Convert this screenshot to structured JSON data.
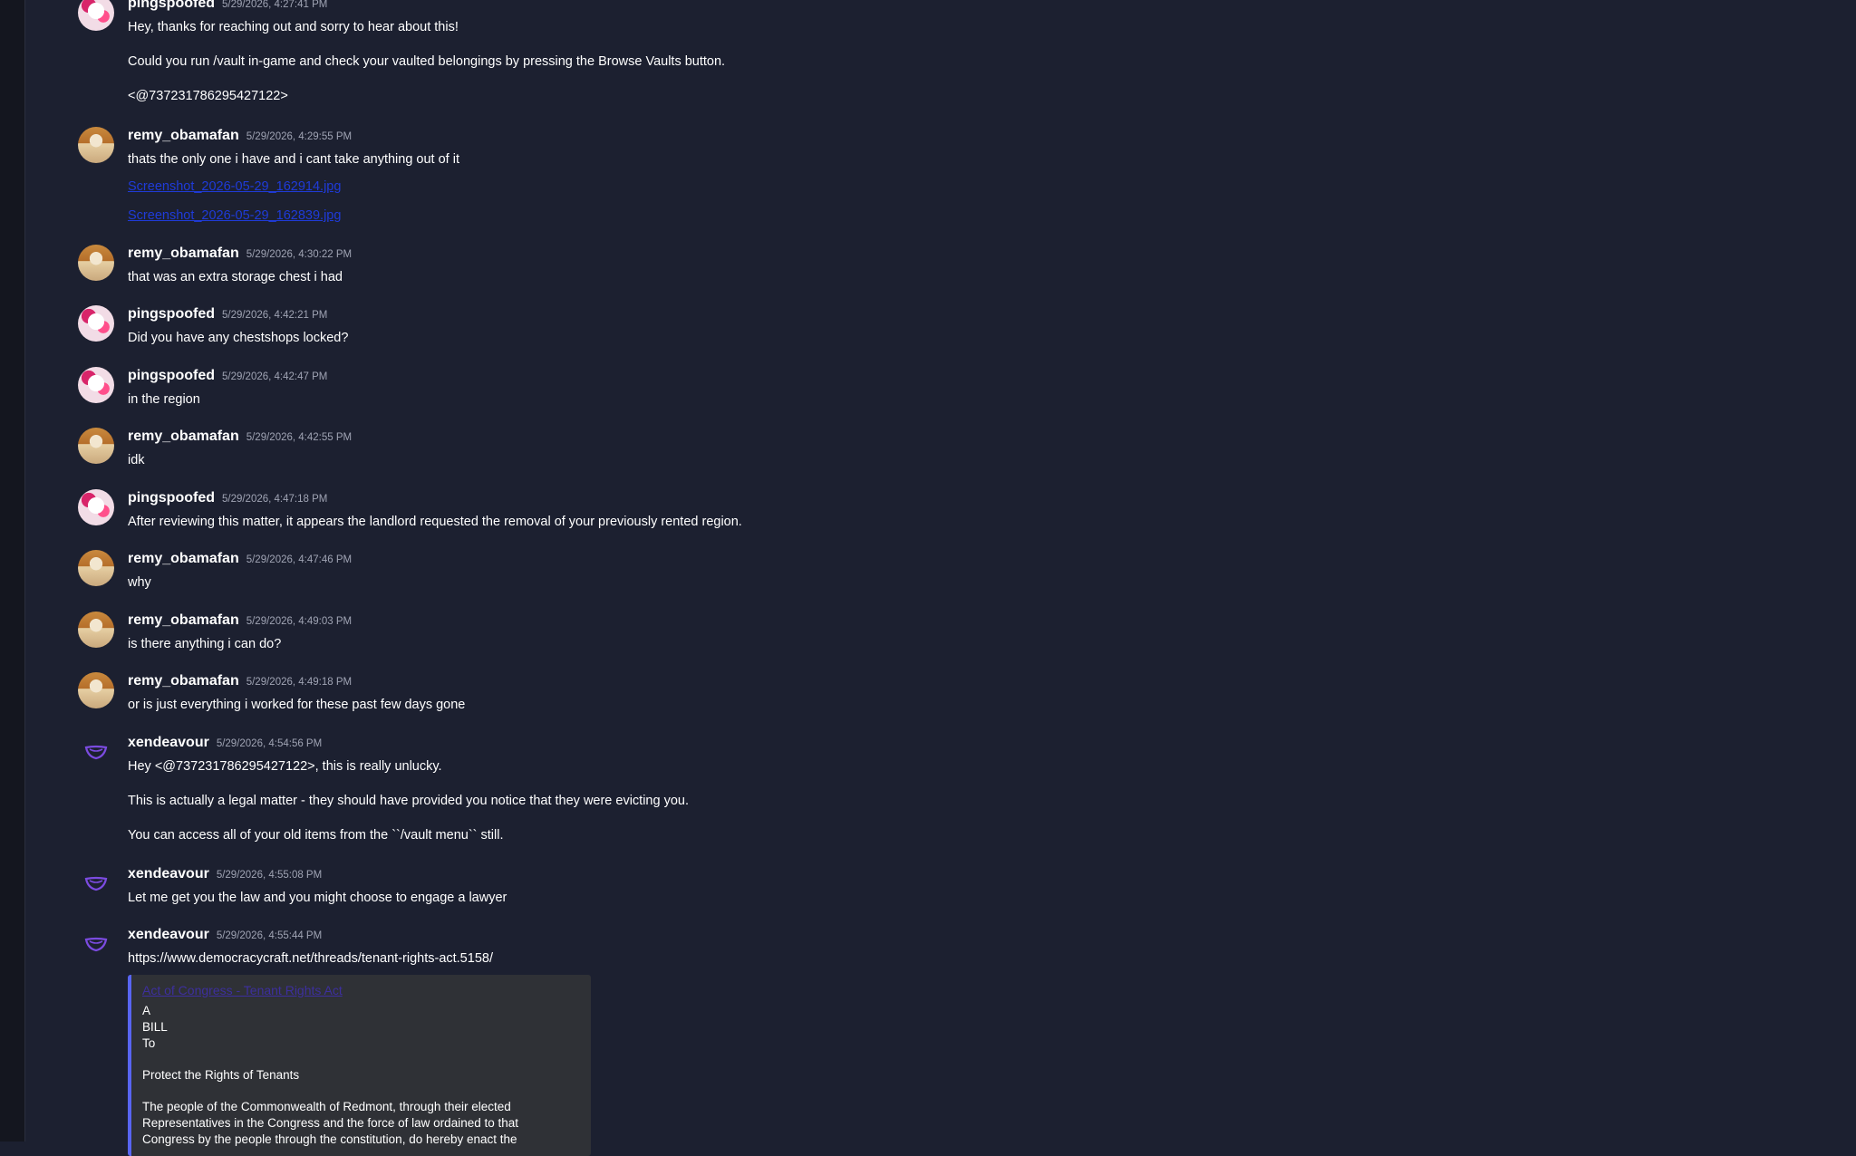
{
  "messages": [
    {
      "user": "pingspoofed",
      "time": "5/29/2026, 4:27:41 PM",
      "avatar": "ping",
      "lines": [
        "Hey, thanks for reaching out and sorry to hear about this!",
        "Could you run /vault in-game and check your vaulted belongings by pressing the Browse Vaults button.",
        "<@737231786295427122>"
      ]
    },
    {
      "user": "remy_obamafan",
      "time": "5/29/2026, 4:29:55 PM",
      "avatar": "remy",
      "lines": [
        "thats the only one i have and i cant take anything out of it"
      ],
      "links": [
        "Screenshot_2026-05-29_162914.jpg",
        "Screenshot_2026-05-29_162839.jpg"
      ]
    },
    {
      "user": "remy_obamafan",
      "time": "5/29/2026, 4:30:22 PM",
      "avatar": "remy",
      "lines": [
        "that was an extra storage chest i had"
      ]
    },
    {
      "user": "pingspoofed",
      "time": "5/29/2026, 4:42:21 PM",
      "avatar": "ping",
      "lines": [
        "Did you have any chestshops locked?"
      ]
    },
    {
      "user": "pingspoofed",
      "time": "5/29/2026, 4:42:47 PM",
      "avatar": "ping",
      "lines": [
        "in the region"
      ]
    },
    {
      "user": "remy_obamafan",
      "time": "5/29/2026, 4:42:55 PM",
      "avatar": "remy",
      "lines": [
        "idk"
      ]
    },
    {
      "user": "pingspoofed",
      "time": "5/29/2026, 4:47:18 PM",
      "avatar": "ping",
      "lines": [
        "After reviewing this matter, it appears the landlord requested the removal of your previously rented region."
      ]
    },
    {
      "user": "remy_obamafan",
      "time": "5/29/2026, 4:47:46 PM",
      "avatar": "remy",
      "lines": [
        "why"
      ]
    },
    {
      "user": "remy_obamafan",
      "time": "5/29/2026, 4:49:03 PM",
      "avatar": "remy",
      "lines": [
        "is there anything i can do?"
      ]
    },
    {
      "user": "remy_obamafan",
      "time": "5/29/2026, 4:49:18 PM",
      "avatar": "remy",
      "lines": [
        "or is just everything i worked for these past few days gone"
      ]
    },
    {
      "user": "xendeavour",
      "time": "5/29/2026, 4:54:56 PM",
      "avatar": "xen",
      "lines": [
        "Hey <@737231786295427122>, this is really unlucky.",
        "This is actually a legal matter - they should have provided you notice that they were evicting you.",
        "You can access all of your old items from the ``/vault menu`` still."
      ]
    },
    {
      "user": "xendeavour",
      "time": "5/29/2026, 4:55:08 PM",
      "avatar": "xen",
      "lines": [
        "Let me get you the law and you might choose to engage a lawyer"
      ]
    },
    {
      "user": "xendeavour",
      "time": "5/29/2026, 4:55:44 PM",
      "avatar": "xen",
      "lines": [
        "https://www.democracycraft.net/threads/tenant-rights-act.5158/"
      ]
    }
  ],
  "embed": {
    "title": "Act of Congress - Tenant Rights Act",
    "lines": [
      "A",
      "BILL",
      "To",
      "",
      "Protect the Rights of Tenants",
      "",
      "The people of the Commonwealth of Redmont, through their elected",
      "Representatives in the Congress and the force of law ordained to that",
      "Congress by the people through the constitution, do hereby enact the"
    ]
  },
  "colors": {
    "background": "#1c2030",
    "accent": "#5865f2",
    "link": "#1f3bd9",
    "timestamp": "#a0a4b4"
  }
}
